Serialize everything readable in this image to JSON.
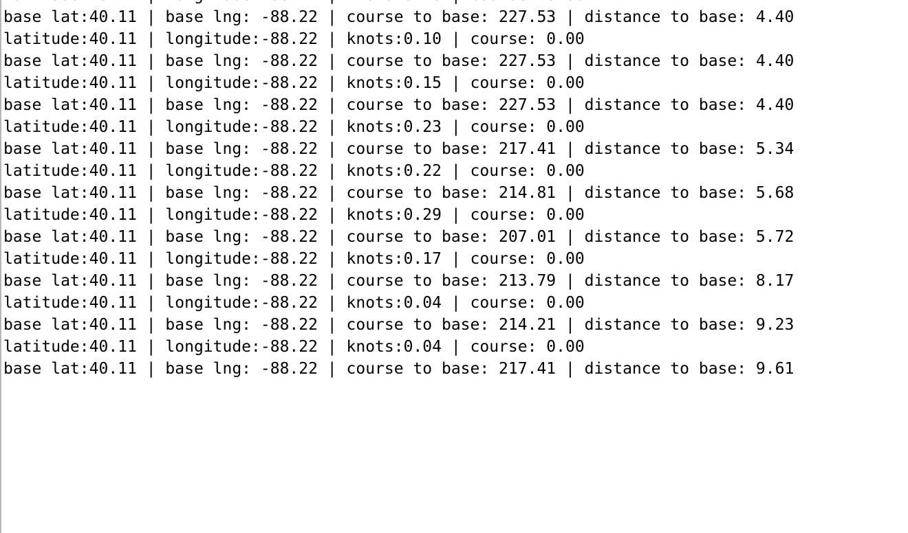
{
  "serial_output": {
    "lines": [
      "latitude:40.11 | longitude:-88.22 | knots:0.10 | course: 0.00",
      "base lat:40.11 | base lng: -88.22 | course to base: 227.53 | distance to base: 4.40",
      "latitude:40.11 | longitude:-88.22 | knots:0.10 | course: 0.00",
      "base lat:40.11 | base lng: -88.22 | course to base: 227.53 | distance to base: 4.40",
      "latitude:40.11 | longitude:-88.22 | knots:0.15 | course: 0.00",
      "base lat:40.11 | base lng: -88.22 | course to base: 227.53 | distance to base: 4.40",
      "latitude:40.11 | longitude:-88.22 | knots:0.23 | course: 0.00",
      "base lat:40.11 | base lng: -88.22 | course to base: 217.41 | distance to base: 5.34",
      "latitude:40.11 | longitude:-88.22 | knots:0.22 | course: 0.00",
      "base lat:40.11 | base lng: -88.22 | course to base: 214.81 | distance to base: 5.68",
      "latitude:40.11 | longitude:-88.22 | knots:0.29 | course: 0.00",
      "base lat:40.11 | base lng: -88.22 | course to base: 207.01 | distance to base: 5.72",
      "latitude:40.11 | longitude:-88.22 | knots:0.17 | course: 0.00",
      "base lat:40.11 | base lng: -88.22 | course to base: 213.79 | distance to base: 8.17",
      "latitude:40.11 | longitude:-88.22 | knots:0.04 | course: 0.00",
      "base lat:40.11 | base lng: -88.22 | course to base: 214.21 | distance to base: 9.23",
      "latitude:40.11 | longitude:-88.22 | knots:0.04 | course: 0.00",
      "base lat:40.11 | base lng: -88.22 | course to base: 217.41 | distance to base: 9.61"
    ]
  }
}
